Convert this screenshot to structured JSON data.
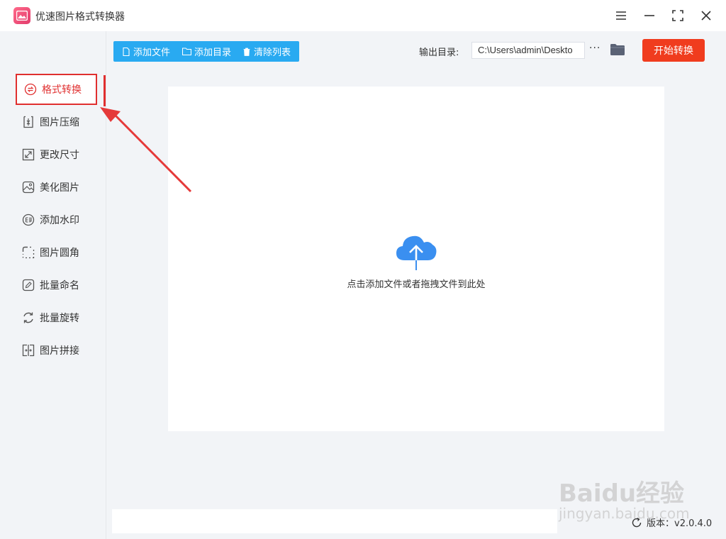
{
  "app": {
    "title": "优速图片格式转换器",
    "accent": "#e02f2f"
  },
  "window_controls": {
    "menu_icon": "menu-icon",
    "minimize_icon": "minimize-icon",
    "maximize_icon": "maximize-icon",
    "close_icon": "close-icon"
  },
  "sidebar": {
    "items": [
      {
        "label": "格式转换",
        "icon": "convert-icon",
        "active": true
      },
      {
        "label": "图片压缩",
        "icon": "compress-icon"
      },
      {
        "label": "更改尺寸",
        "icon": "resize-icon"
      },
      {
        "label": "美化图片",
        "icon": "beautify-icon"
      },
      {
        "label": "添加水印",
        "icon": "watermark-icon"
      },
      {
        "label": "图片圆角",
        "icon": "rounded-corner-icon"
      },
      {
        "label": "批量命名",
        "icon": "rename-icon"
      },
      {
        "label": "批量旋转",
        "icon": "rotate-icon"
      },
      {
        "label": "图片拼接",
        "icon": "stitch-icon"
      }
    ]
  },
  "toolbar": {
    "add_file": "添加文件",
    "add_folder": "添加目录",
    "clear_list": "清除列表",
    "color": "#29aaf1"
  },
  "output": {
    "label": "输出目录:",
    "path": "C:\\Users\\admin\\Deskto",
    "more": "···"
  },
  "start_button": {
    "label": "开始转换",
    "color": "#f03c1e"
  },
  "dropzone": {
    "hint": "点击添加文件或者拖拽文件到此处",
    "icon": "cloud-upload-icon"
  },
  "footer": {
    "version": "版本：v2.0.4.0"
  },
  "watermark": {
    "logo": "Baidu经验",
    "url": "jingyan.baidu.com"
  }
}
